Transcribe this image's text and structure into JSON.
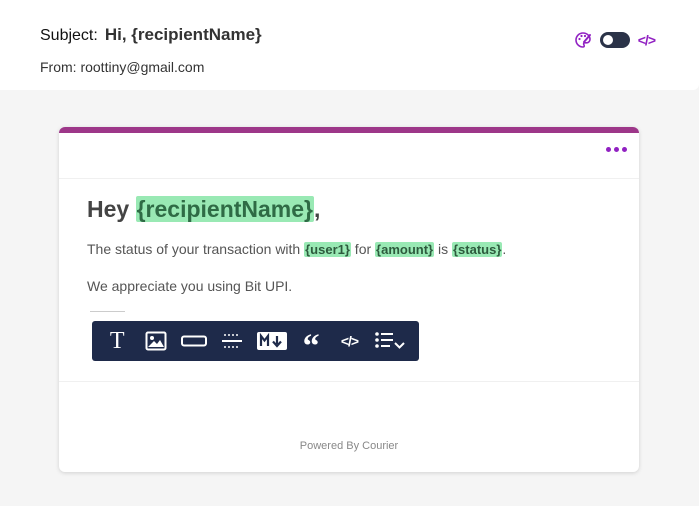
{
  "header": {
    "subject_label": "Subject:",
    "subject_value": "Hi, {recipientName}",
    "from_text": "From: roottiny@gmail.com",
    "tools": {
      "palette_icon": "palette-icon",
      "toggle_icon": "toggle-icon",
      "code_label": "</>"
    }
  },
  "card": {
    "accent_color": "#9d3789",
    "menu_icon": "more-horizontal-icon",
    "greeting": {
      "prefix": "Hey ",
      "variable": "{recipientName}",
      "suffix": ","
    },
    "line1": {
      "t1": "The status of your transaction with ",
      "v1": "{user1}",
      "t2": " for ",
      "v2": "{amount}",
      "t3": " is ",
      "v3": "{status}",
      "t4": "."
    },
    "line2": "We appreciate you using Bit UPI.",
    "toolbar": {
      "text_label": "T",
      "quote_label": "“",
      "code_label": "</>",
      "icons": [
        "text-icon",
        "image-icon",
        "button-block-icon",
        "divider-icon",
        "markdown-icon",
        "quote-icon",
        "code-icon",
        "list-dropdown-icon"
      ]
    },
    "footer": "Powered By Courier"
  },
  "colors": {
    "variable_highlight": "#99e9b4",
    "toolbar_bg": "#1e2a4a",
    "brand_purple": "#9121c2"
  }
}
